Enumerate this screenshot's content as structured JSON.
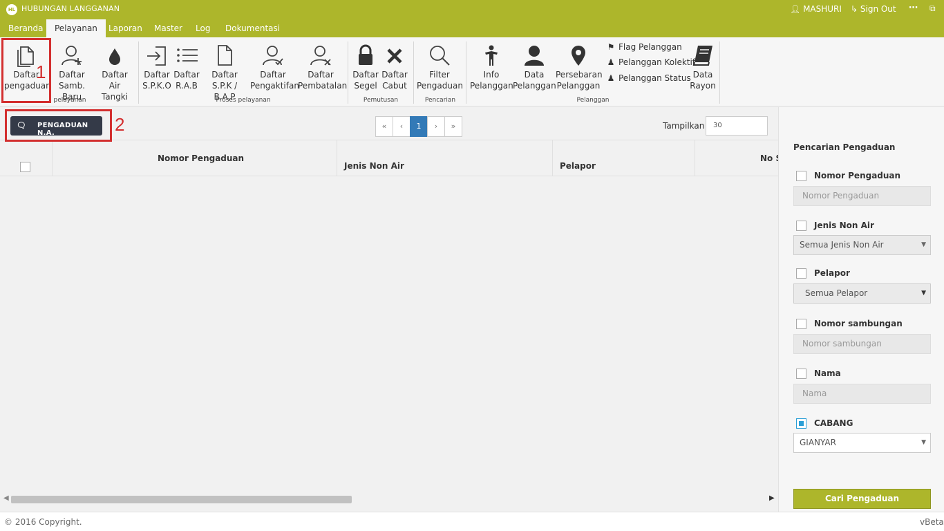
{
  "app": {
    "logo_text": "HL",
    "title": "HUBUNGAN LANGGANAN",
    "user_name": "MASHURI",
    "sign_out": "Sign Out",
    "more": "⋯",
    "external": "⧉"
  },
  "menu": {
    "tabs": [
      "Beranda",
      "Pelayanan",
      "Laporan",
      "Master",
      "Log",
      "Dokumentasi"
    ],
    "active": "Pelayanan"
  },
  "ribbon": {
    "groups": [
      "pelayanan",
      "Proses pelayanan",
      "Pemutusan",
      "Pencarian",
      "Pelanggan"
    ],
    "buttons": [
      {
        "line1": "Daftar",
        "line2": "pengaduan",
        "icon": "document-copy-icon"
      },
      {
        "line1": "Daftar",
        "line2": "Samb. Baru",
        "icon": "add-user-icon"
      },
      {
        "line1": "Daftar",
        "line2": "Air Tangki",
        "icon": "water-drop-icon"
      },
      {
        "line1": "Daftar",
        "line2": "S.P.K.O",
        "icon": "sign-in-icon"
      },
      {
        "line1": "Daftar",
        "line2": "R.A.B",
        "icon": "list-icon"
      },
      {
        "line1": "Daftar",
        "line2": "S.P.K / B.A.P",
        "icon": "document-icon"
      },
      {
        "line1": "Daftar",
        "line2": "Pengaktifan",
        "icon": "user-check-icon"
      },
      {
        "line1": "Daftar",
        "line2": "Pembatalan",
        "icon": "user-cancel-icon"
      },
      {
        "line1": "Daftar",
        "line2": "Segel",
        "icon": "lock-icon"
      },
      {
        "line1": "Daftar",
        "line2": "Cabut",
        "icon": "close-x-icon"
      },
      {
        "line1": "Filter",
        "line2": "Pengaduan",
        "icon": "search-icon"
      },
      {
        "line1": "Info",
        "line2": "Pelanggan",
        "icon": "person-standing-icon"
      },
      {
        "line1": "Data",
        "line2": "Pelanggan",
        "icon": "user-icon"
      },
      {
        "line1": "Persebaran",
        "line2": "Pelanggan",
        "icon": "map-marker-icon"
      },
      {
        "line1": "Data",
        "line2": "Rayon",
        "icon": "book-icon"
      }
    ],
    "small_items": [
      {
        "label": "Flag Pelanggan",
        "icon": "tag-icon"
      },
      {
        "label": "Pelanggan Kolektif",
        "icon": "users-icon"
      },
      {
        "label": "Pelanggan Status",
        "icon": "user-status-icon"
      }
    ]
  },
  "annotations": {
    "n1": "1",
    "n2": "2"
  },
  "list": {
    "button_label": "PENGADUAN N.A.",
    "pager": [
      "«",
      "‹",
      "1",
      "›",
      "»"
    ],
    "active_page": 1,
    "show_label": "Tampilkan :",
    "show_value": "30",
    "columns": [
      "Nomor Pengaduan",
      "Jenis Non Air",
      "Pelapor",
      "No S"
    ]
  },
  "search": {
    "title": "Pencarian Pengaduan",
    "filters": [
      {
        "label": "Nomor Pengaduan",
        "type": "input",
        "placeholder": "Nomor Pengaduan",
        "checked": false
      },
      {
        "label": "Jenis Non Air",
        "type": "select",
        "value": "Semua Jenis Non Air",
        "checked": false
      },
      {
        "label": "Pelapor",
        "type": "select",
        "value": "Semua Pelapor",
        "checked": false
      },
      {
        "label": "Nomor sambungan",
        "type": "input",
        "placeholder": "Nomor sambungan",
        "checked": false
      },
      {
        "label": "Nama",
        "type": "input",
        "placeholder": "Nama",
        "checked": false
      },
      {
        "label": "CABANG",
        "type": "select",
        "value": "GIANYAR",
        "checked": true
      }
    ],
    "button": "Cari Pengaduan"
  },
  "footer": {
    "copyright": "© 2016 Copyright.",
    "version": "vBeta"
  },
  "colors": {
    "brand": "#adb62b",
    "dark_button": "#343a48",
    "pager_active": "#337ab7",
    "annotation": "#d32f2f",
    "checkbox_active": "#2a9fd6"
  }
}
